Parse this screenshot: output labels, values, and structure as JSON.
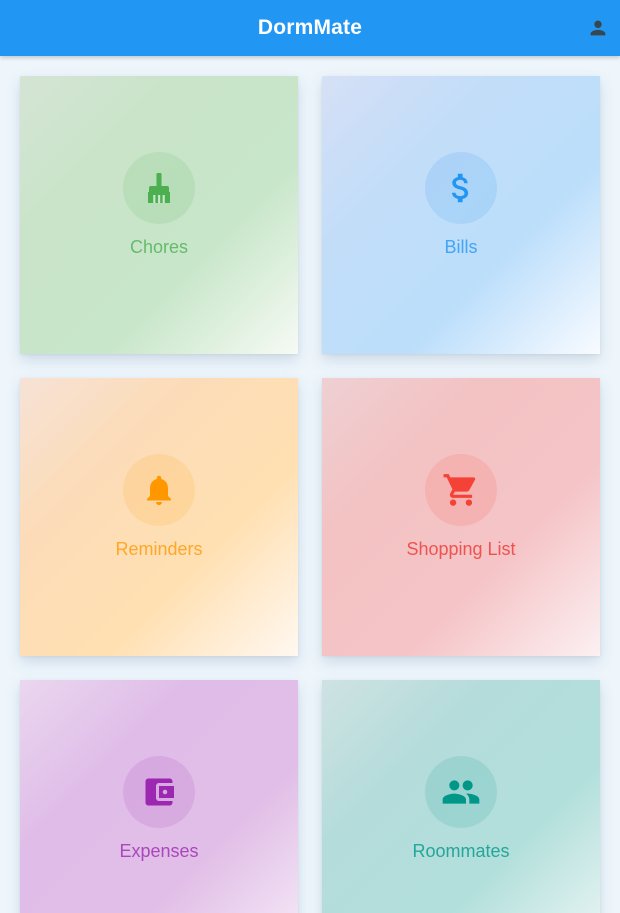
{
  "app": {
    "title": "DormMate",
    "profile_icon": "person-icon",
    "primary_color": "#2196f3"
  },
  "tiles": [
    {
      "label": "Chores",
      "icon": "broom-icon",
      "color": "#4caf50"
    },
    {
      "label": "Bills",
      "icon": "dollar-icon",
      "color": "#2196f3"
    },
    {
      "label": "Reminders",
      "icon": "bell-icon",
      "color": "#ff9800"
    },
    {
      "label": "Shopping List",
      "icon": "shopping-cart-icon",
      "color": "#f44336"
    },
    {
      "label": "Expenses",
      "icon": "wallet-icon",
      "color": "#9c27b0"
    },
    {
      "label": "Roommates",
      "icon": "people-icon",
      "color": "#009688"
    }
  ]
}
